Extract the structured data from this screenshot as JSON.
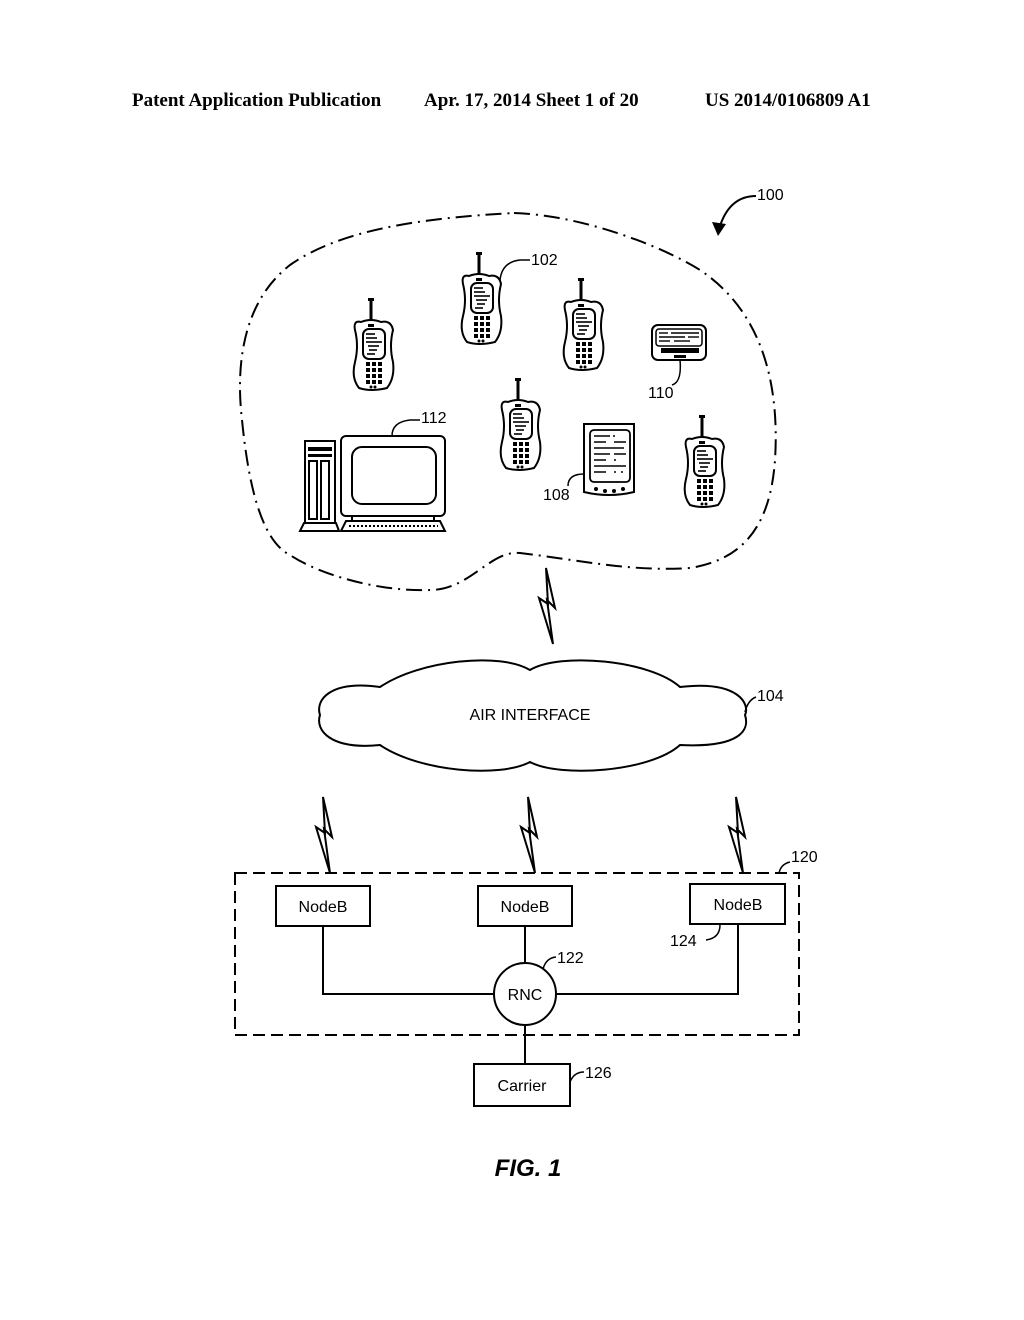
{
  "header": {
    "left": "Patent Application Publication",
    "middle": "Apr. 17, 2014  Sheet 1 of 20",
    "right": "US 2014/0106809 A1"
  },
  "figure": {
    "caption": "FIG. 1",
    "system_ref": "100",
    "devices": {
      "phone_ref": "102",
      "pda_ref": "108",
      "pager_ref": "110",
      "computer_ref": "112"
    },
    "air_interface": {
      "label": "AIR INTERFACE",
      "ref": "104"
    },
    "access_network": {
      "ref": "120",
      "nodes": [
        {
          "label": "NodeB"
        },
        {
          "label": "NodeB"
        },
        {
          "label": "NodeB"
        }
      ],
      "nodeb_ref": "124",
      "rnc": {
        "label": "RNC",
        "ref": "122"
      }
    },
    "carrier": {
      "label": "Carrier",
      "ref": "126"
    }
  }
}
